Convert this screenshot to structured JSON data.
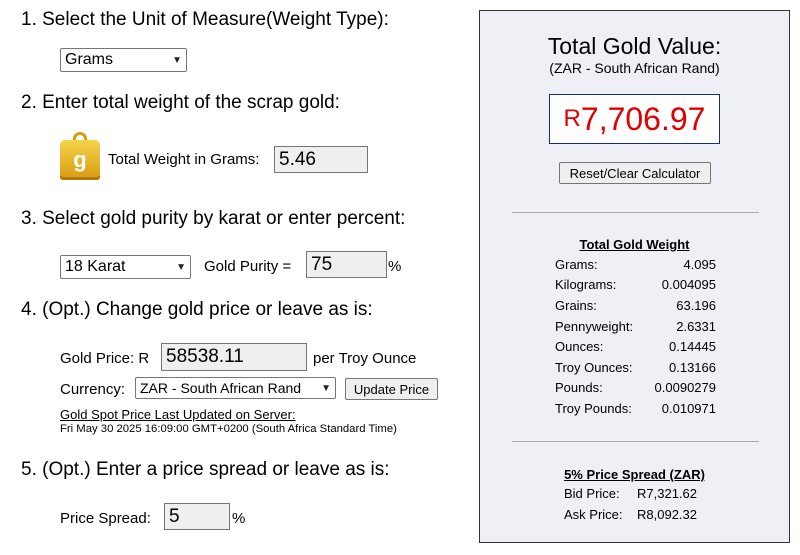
{
  "step1": {
    "title": "1. Select the Unit of Measure(Weight Type):",
    "unit_select": "Grams"
  },
  "step2": {
    "title": "2. Enter total weight of the scrap gold:",
    "icon_letter": "g",
    "weight_label": "Total Weight in Grams:",
    "weight_value": "5.46"
  },
  "step3": {
    "title": "3. Select gold purity by karat or enter percent:",
    "karat_select": "18 Karat",
    "purity_label": "Gold Purity =",
    "purity_value": "75",
    "purity_unit": "%"
  },
  "step4": {
    "title": "4. (Opt.) Change gold price or leave as is:",
    "price_label": "Gold Price: R",
    "price_value": "58538.11",
    "price_suffix": "per Troy Ounce",
    "currency_label": "Currency:",
    "currency_select": "ZAR - South African Rand",
    "update_button": "Update Price",
    "spot_link": "Gold Spot Price Last Updated on Server:",
    "spot_time": "Fri May 30 2025 16:09:00 GMT+0200 (South Africa Standard Time)"
  },
  "step5": {
    "title": "5. (Opt.) Enter a price spread or leave as is:",
    "spread_label": "Price Spread:",
    "spread_value": "5",
    "spread_unit": "%"
  },
  "panel": {
    "title": "Total Gold Value:",
    "subtitle": "(ZAR - South African Rand)",
    "currency_symbol": "R",
    "total_value": "7,706.97",
    "reset_button": "Reset/Clear Calculator",
    "weight_heading": "Total Gold Weight",
    "weights": [
      {
        "label": "Grams:",
        "value": "4.095"
      },
      {
        "label": "Kilograms:",
        "value": "0.004095"
      },
      {
        "label": "Grains:",
        "value": "63.196"
      },
      {
        "label": "Pennyweight:",
        "value": "2.6331"
      },
      {
        "label": "Ounces:",
        "value": "0.14445"
      },
      {
        "label": "Troy Ounces:",
        "value": "0.13166"
      },
      {
        "label": "Pounds:",
        "value": "0.0090279"
      },
      {
        "label": "Troy Pounds:",
        "value": "0.010971"
      }
    ],
    "spread_heading": "5% Price Spread (ZAR)",
    "bid_label": "Bid Price:",
    "bid_value": "R7,321.62",
    "ask_label": "Ask Price:",
    "ask_value": "R8,092.32"
  },
  "colors": {
    "total_value": "#e00000",
    "link": "#000000",
    "panel_bg": "#eff0f6",
    "icon_gold": "#e0a820"
  }
}
